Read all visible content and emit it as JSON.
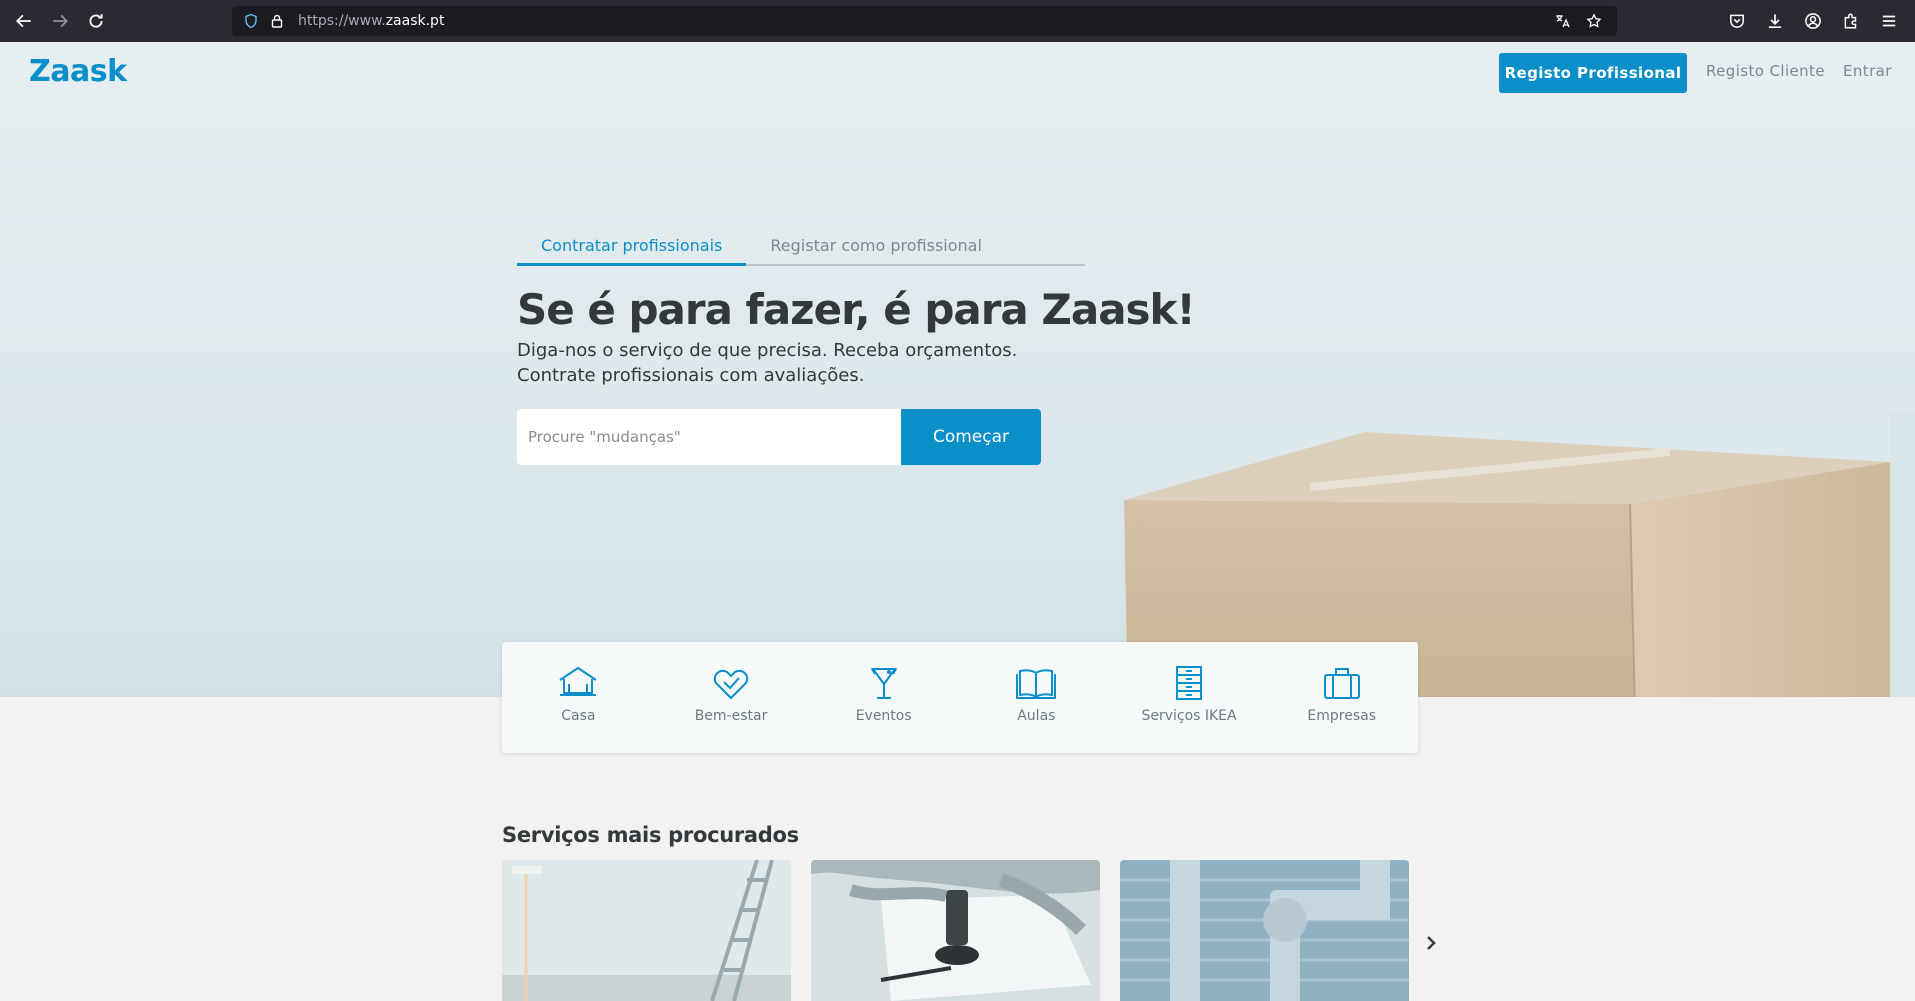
{
  "browser": {
    "url_protocol": "https://www.",
    "url_host": "zaask.pt"
  },
  "header": {
    "logo": "Zaask",
    "register_pro_label": "Registo Profissional",
    "register_client_label": "Registo Cliente",
    "login_label": "Entrar"
  },
  "hero": {
    "tabs": [
      {
        "label": "Contratar profissionais",
        "active": true
      },
      {
        "label": "Registar como profissional",
        "active": false
      }
    ],
    "headline": "Se é para fazer, é para Zaask!",
    "subline": "Diga-nos o serviço de que precisa. Receba orçamentos. Contrate profissionais com avaliações.",
    "search_placeholder": "Procure \"mudanças\"",
    "search_value": "",
    "start_label": "Começar"
  },
  "categories": [
    {
      "label": "Casa",
      "icon": "house-icon"
    },
    {
      "label": "Bem-estar",
      "icon": "heart-icon"
    },
    {
      "label": "Eventos",
      "icon": "cocktail-icon"
    },
    {
      "label": "Aulas",
      "icon": "book-icon"
    },
    {
      "label": "Serviços IKEA",
      "icon": "drawers-icon"
    },
    {
      "label": "Empresas",
      "icon": "briefcase-icon"
    }
  ],
  "popular": {
    "title": "Serviços mais procurados",
    "cards": [
      {
        "image": "painting-ladder-image"
      },
      {
        "image": "notary-stamp-image"
      },
      {
        "image": "plumbing-pipes-image"
      }
    ]
  },
  "colors": {
    "brand": "#0a8fc8",
    "heading": "#33383a",
    "muted": "#7a8a92"
  }
}
